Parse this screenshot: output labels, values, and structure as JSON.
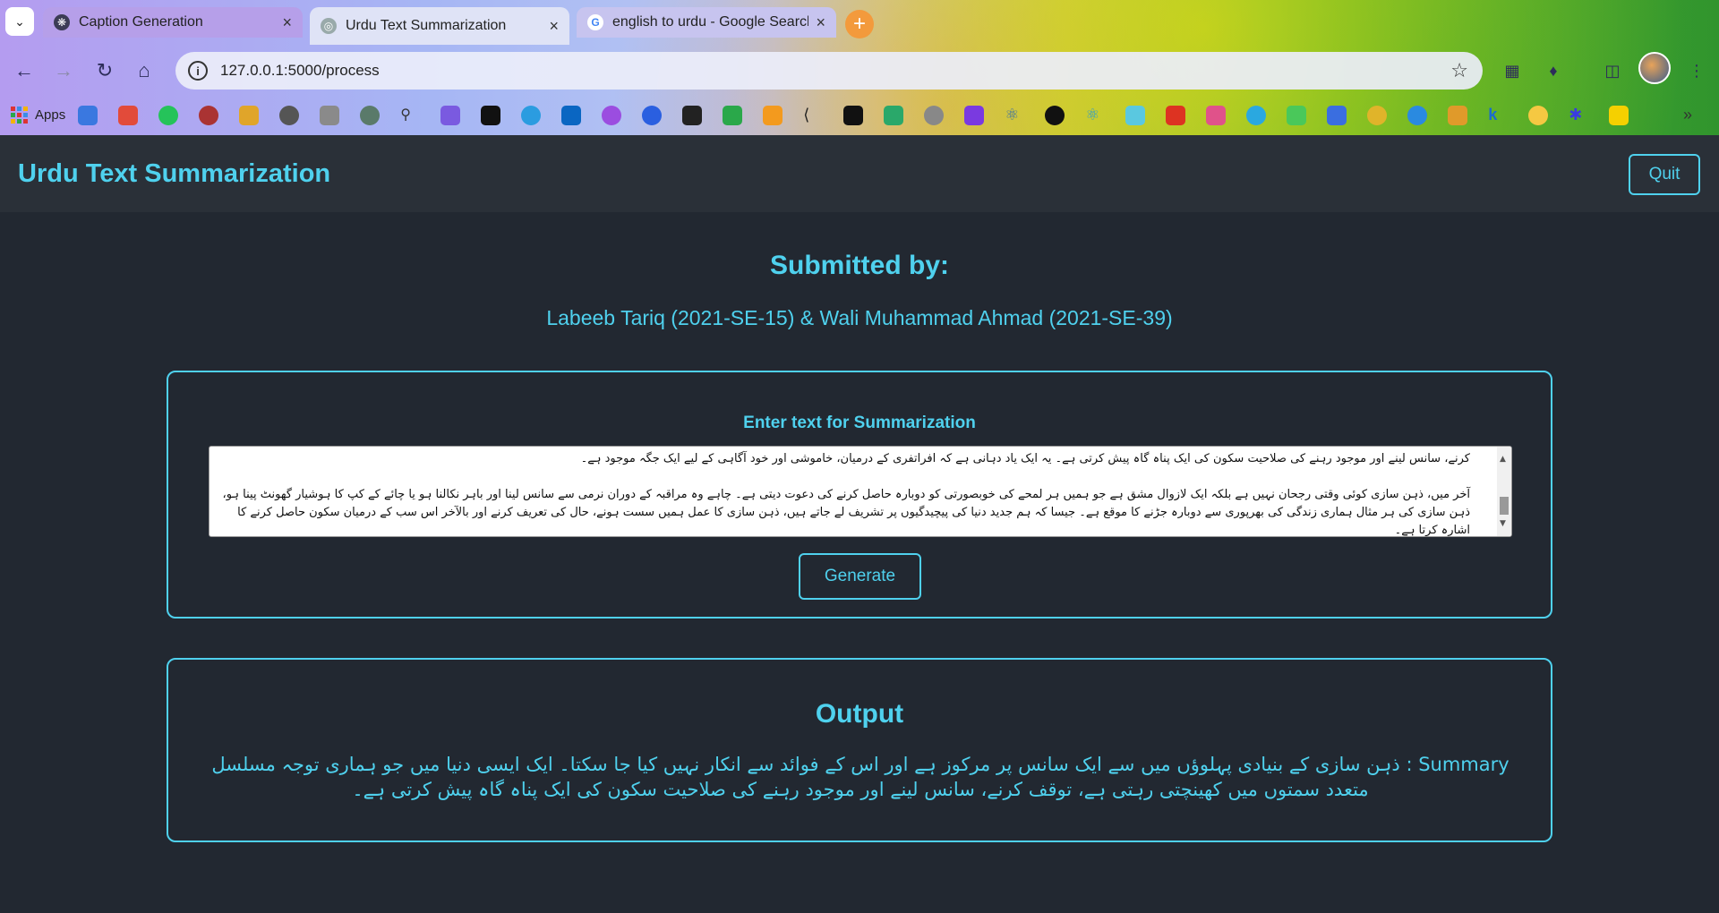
{
  "browser": {
    "tabs": [
      {
        "title": "Caption Generation",
        "icon": "openai-icon",
        "active": false
      },
      {
        "title": "Urdu Text Summarization",
        "icon": "globe-icon",
        "active": true
      },
      {
        "title": "english to urdu - Google Search",
        "icon": "google-icon",
        "active": false
      }
    ],
    "url": "127.0.0.1:5000/process",
    "bookmarks_apps_label": "Apps"
  },
  "header": {
    "title": "Urdu Text Summarization",
    "quit_label": "Quit"
  },
  "submitted": {
    "heading": "Submitted by:",
    "names": "Labeeb Tariq (2021-SE-15) & Wali Muhammad Ahmad (2021-SE-39)"
  },
  "input": {
    "label": "Enter text for Summarization",
    "text_line1": "کرنے، سانس لینے اور موجود رہنے کی صلاحیت سکون کی ایک پناہ گاہ پیش کرتی ہے۔ یہ ایک یاد دہانی ہے کہ افراتفری کے درمیان، خاموشی اور خود آگاہی کے لیے ایک جگہ موجود ہے۔",
    "text_para2": "آخر میں، ذہن سازی کوئی وقتی رجحان نہیں ہے بلکہ ایک لازوال مشق ہے جو ہمیں ہر لمحے کی خوبصورتی کو دوبارہ حاصل کرنے کی دعوت دیتی ہے۔ چاہے وہ مراقبہ کے دوران نرمی سے سانس لینا اور باہر نکالنا ہو یا چائے کے کپ کا ہوشیار گھونٹ پینا ہو، ذہن سازی کی ہر مثال ہماری زندگی کی بھرپوری سے دوبارہ جڑنے کا موقع ہے۔ جیسا کہ ہم جدید دنیا کی پیچیدگیوں پر تشریف لے جاتے ہیں، ذہن سازی کا عمل ہمیں سست ہونے، حال کی تعریف کرنے اور بالآخر اس سب کے درمیان سکون حاصل کرنے کا اشارہ کرتا ہے۔",
    "generate_label": "Generate"
  },
  "output": {
    "title": "Output",
    "summary": "Summary : ذہن سازی کے بنیادی پہلوؤں میں سے ایک سانس پر مرکوز ہے اور اس کے فوائد سے انکار نہیں کیا جا سکتا۔ ایک ایسی دنیا میں جو ہماری توجہ مسلسل متعدد سمتوں میں کھینچتی رہتی ہے، توقف کرنے، سانس لینے اور موجود رہنے کی صلاحیت سکون کی ایک پناہ گاہ پیش کرتی ہے۔"
  },
  "colors": {
    "accent": "#4fd1ee",
    "page_bg": "#222831",
    "header_bg": "#2a3038"
  }
}
